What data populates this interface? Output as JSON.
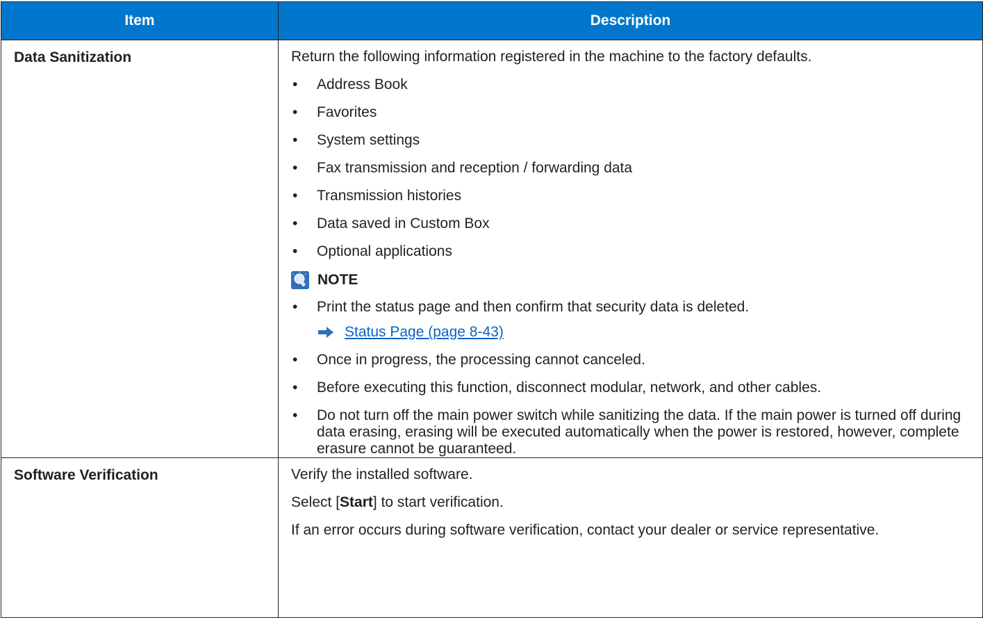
{
  "table": {
    "headers": {
      "item": "Item",
      "description": "Description"
    },
    "row1": {
      "item": "Data Sanitization",
      "intro": "Return the following information registered in the machine to the factory defaults.",
      "bullets": [
        "Address Book",
        "Favorites",
        "System settings",
        "Fax transmission and reception / forwarding data",
        "Transmission histories",
        "Data saved in Custom Box",
        "Optional applications"
      ],
      "note_label": "NOTE",
      "note_first": "Print the status page and then confirm that security data is deleted.",
      "note_link": "Status Page (page 8-43)",
      "note_rest": [
        "Once in progress, the processing cannot canceled.",
        "Before executing this function, disconnect modular, network, and other cables.",
        "Do not turn off the main power switch while sanitizing the data. If the main power is turned off during data erasing, erasing will be executed automatically when the power is restored, however, complete erasure cannot be guaranteed."
      ]
    },
    "row2": {
      "item": "Software Verification",
      "line1": "Verify the installed software.",
      "select_prefix": "Select [",
      "select_bold": "Start",
      "select_suffix": "] to start verification.",
      "line3": "If an error occurs during software verification, contact your dealer or service representative."
    }
  },
  "bullet_char": "•",
  "colors": {
    "header_bg": "#0077cc",
    "link": "#0b63c4",
    "note_icon": "#2f6fb5"
  },
  "icons": {
    "note": "lightbulb-note-icon",
    "link": "arrow-right-icon"
  }
}
